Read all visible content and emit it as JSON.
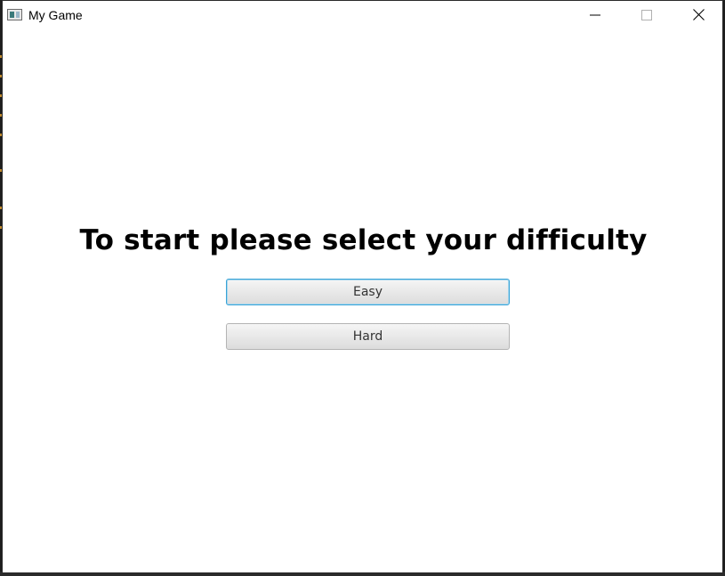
{
  "window": {
    "title": "My Game",
    "icon": "app-window-icon",
    "controls": {
      "minimize_icon": "minimize-icon",
      "maximize_icon": "maximize-icon",
      "close_icon": "close-icon"
    }
  },
  "main": {
    "heading": "To start please select your difficulty",
    "buttons": [
      {
        "label": "Easy",
        "focused": true
      },
      {
        "label": "Hard",
        "focused": false
      }
    ]
  },
  "colors": {
    "focus_border": "#39a3d6",
    "button_text": "#333333",
    "heading_text": "#000000"
  }
}
